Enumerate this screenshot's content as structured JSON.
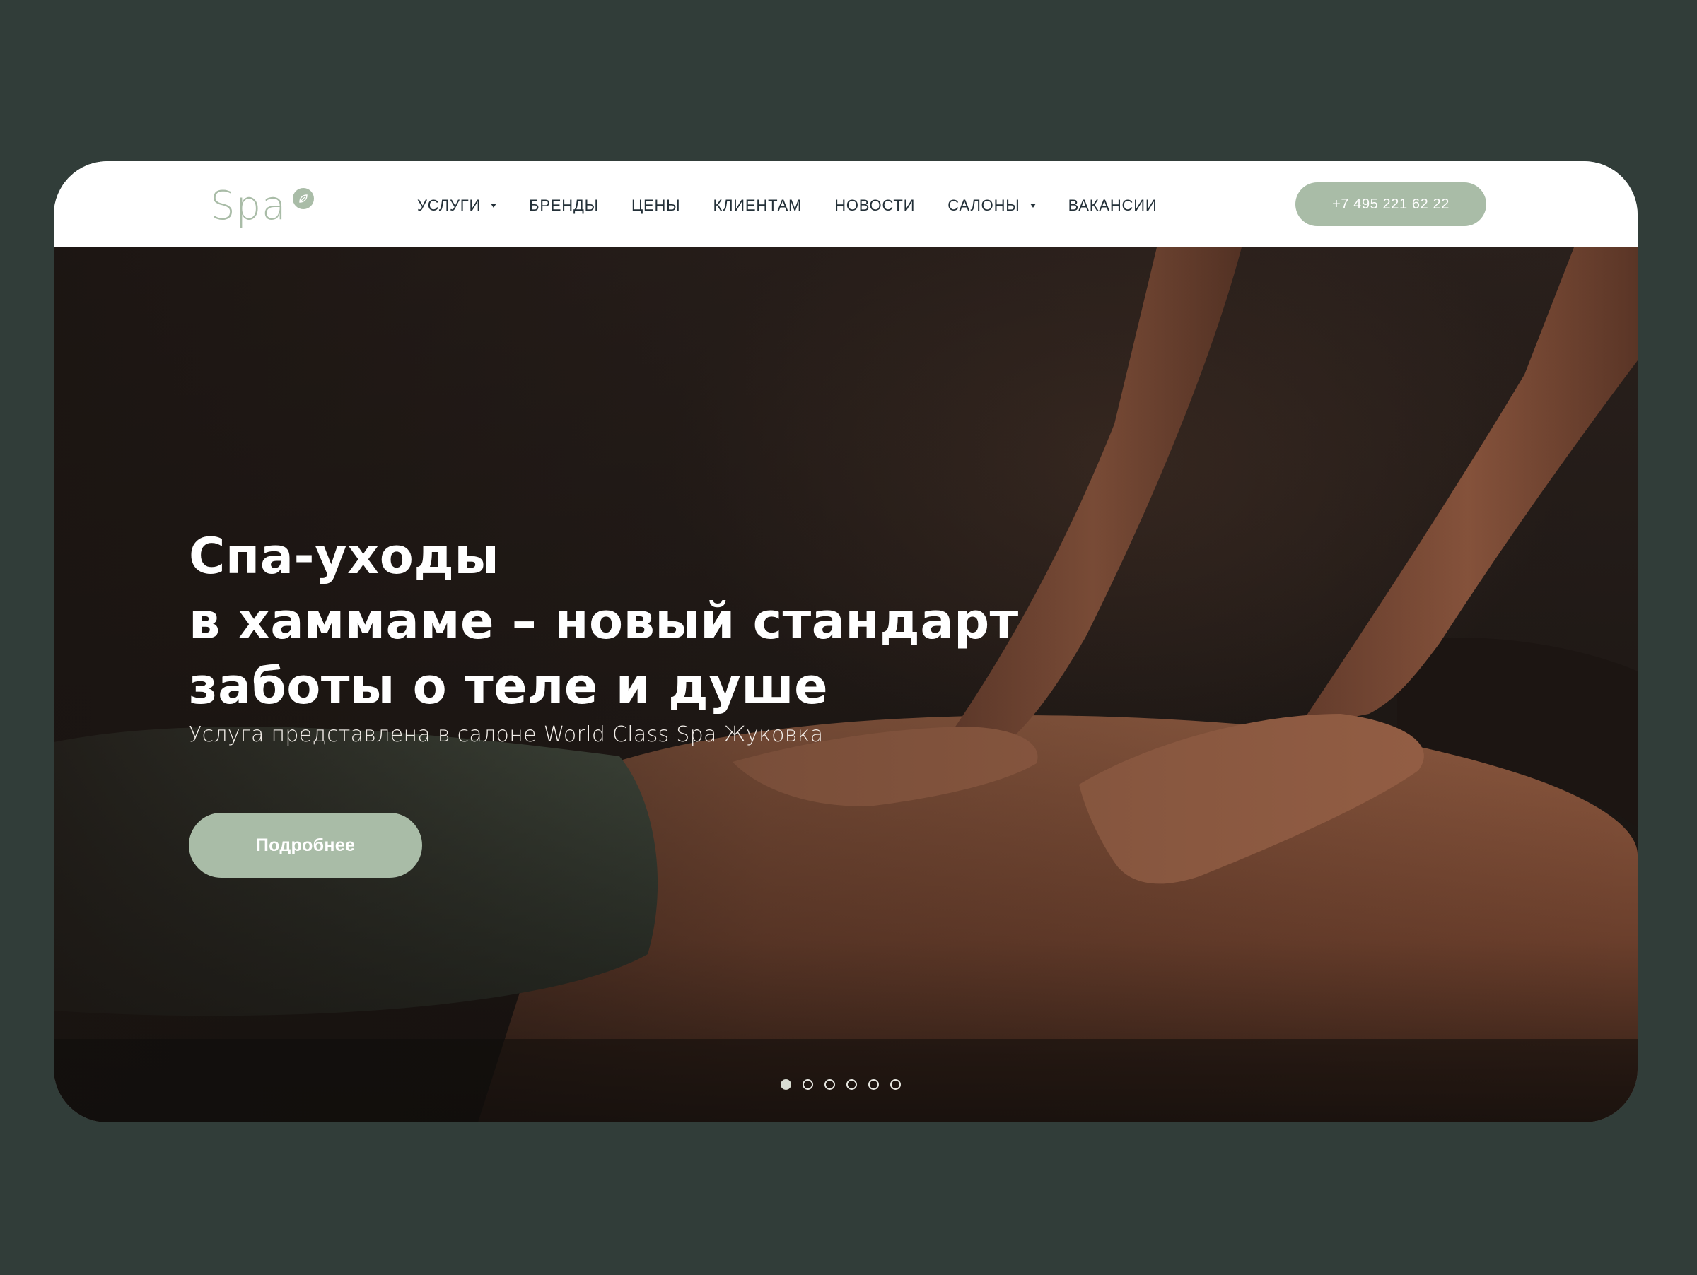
{
  "header": {
    "logo_text": "Spa",
    "nav": [
      {
        "label": "УСЛУГИ",
        "dropdown": true
      },
      {
        "label": "БРЕНДЫ",
        "dropdown": false
      },
      {
        "label": "ЦЕНЫ",
        "dropdown": false
      },
      {
        "label": "КЛИЕНТАМ",
        "dropdown": false
      },
      {
        "label": "НОВОСТИ",
        "dropdown": false
      },
      {
        "label": "САЛОНЫ",
        "dropdown": true
      },
      {
        "label": "ВАКАНСИИ",
        "dropdown": false
      }
    ],
    "phone": "+7 495 221 62 22"
  },
  "hero": {
    "title_lines": [
      "Спа-уходы",
      "в хаммаме – новый стандарт",
      "заботы о теле и душе"
    ],
    "subtitle": "Услуга представлена в салоне World Class Spa Жуковка",
    "button_label": "Подробнее",
    "slides_total": 6,
    "active_slide": 1
  },
  "colors": {
    "page_bg": "#313d39",
    "accent": "#a9bca7",
    "nav_text": "#233038"
  },
  "icons": [
    "logo-leaf-icon",
    "caret-down-icon"
  ]
}
